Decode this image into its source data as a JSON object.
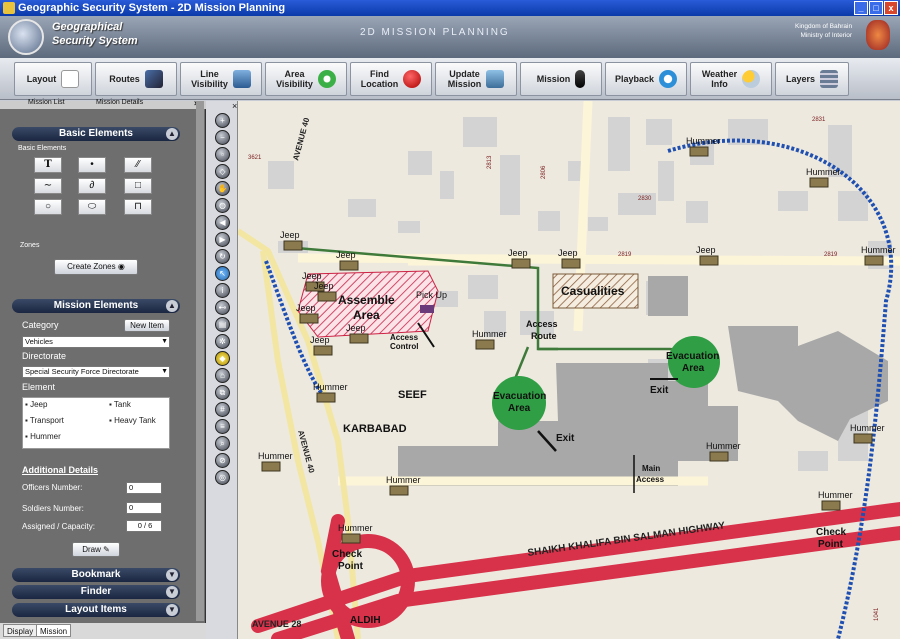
{
  "window": {
    "title": "Geographic Security System - 2D Mission Planning"
  },
  "banner": {
    "app_title_1": "Geographical",
    "app_title_2": "Security System",
    "center_title": "2D MISSION PLANNING",
    "kingdom": "Kingdom of Bahrain",
    "ministry": "Ministry of Interior"
  },
  "toolbar": [
    {
      "label1": "Layout",
      "label2": "",
      "icon": "document-icon"
    },
    {
      "label1": "Routes",
      "label2": "",
      "icon": "jet-icon"
    },
    {
      "label1": "Line",
      "label2": "Visibility",
      "icon": "city-icon"
    },
    {
      "label1": "Area",
      "label2": "Visibility",
      "icon": "eye-icon"
    },
    {
      "label1": "Find",
      "label2": "Location",
      "icon": "pin-icon"
    },
    {
      "label1": "Update",
      "label2": "Mission",
      "icon": "update-icon"
    },
    {
      "label1": "Mission",
      "label2": "",
      "icon": "microphone-icon"
    },
    {
      "label1": "Playback",
      "label2": "",
      "icon": "playback-icon"
    },
    {
      "label1": "Weather",
      "label2": "Info",
      "icon": "weather-icon"
    },
    {
      "label1": "Layers",
      "label2": "",
      "icon": "layers-icon"
    }
  ],
  "left": {
    "tab1": "Mission List",
    "tab2": "Mission Details",
    "basic_elements_header": "Basic Elements",
    "basic_elements_group": "Basic Elements",
    "zones_group": "Zones",
    "create_zones": "Create Zones",
    "mission_elements_header": "Mission Elements",
    "category_label": "Category",
    "new_item": "New Item",
    "category_value": "Vehicles",
    "directorate_label": "Directorate",
    "directorate_value": "Special Security Force Directorate",
    "element_label": "Element",
    "elements": [
      "Jeep",
      "Tank",
      "Transport",
      "Heavy Tank",
      "Hummer"
    ],
    "additional_details": "Additional Details",
    "officers_label": "Officers Number:",
    "officers_value": "0",
    "soldiers_label": "Soldiers Number:",
    "soldiers_value": "0",
    "capacity_label": "Assigned / Capacity:",
    "capacity_value": "0 / 6",
    "draw": "Draw",
    "bookmark": "Bookmark",
    "finder": "Finder",
    "layout_items": "Layout Items",
    "bottom_tab1": "Display",
    "bottom_tab2": "Mission"
  },
  "map": {
    "streets": [
      "AVENUE 40",
      "AVENUE 40",
      "AVENUE 28",
      "SHAIKH KHALIFA BIN SALMAN HIGHWAY"
    ],
    "places": [
      "SEEF",
      "KARBABAD",
      "ALDIH"
    ],
    "zones": {
      "assemble1": "Assemble",
      "assemble2": "Area",
      "casualities": "Casualities",
      "evac_a1": "Evacuation",
      "evac_a2": "Area",
      "evac_b1": "Evacuation",
      "evac_b2": "Area"
    },
    "labels": {
      "pickup": "Pick Up",
      "access_control1": "Access",
      "access_control2": "Control",
      "access_route1": "Access",
      "access_route2": "Route",
      "exit1": "Exit",
      "exit2": "Exit",
      "main_access1": "Main",
      "main_access2": "Access",
      "checkpoint_a1": "Check",
      "checkpoint_a2": "Point",
      "checkpoint_b1": "Check",
      "checkpoint_b2": "Point"
    },
    "vehicles": [
      "Jeep",
      "Jeep",
      "Jeep",
      "Jeep",
      "Jeep",
      "Jeep",
      "Jeep",
      "Jeep",
      "Jeep",
      "Jeep",
      "Hummer",
      "Hummer",
      "Hummer",
      "Hummer",
      "Hummer",
      "Hummer",
      "Hummer",
      "Hummer",
      "Hummer",
      "Hummer",
      "Hummer"
    ],
    "codes": [
      "3621",
      "2813",
      "2806",
      "2831",
      "2830",
      "2819",
      "2819",
      "1041"
    ]
  }
}
